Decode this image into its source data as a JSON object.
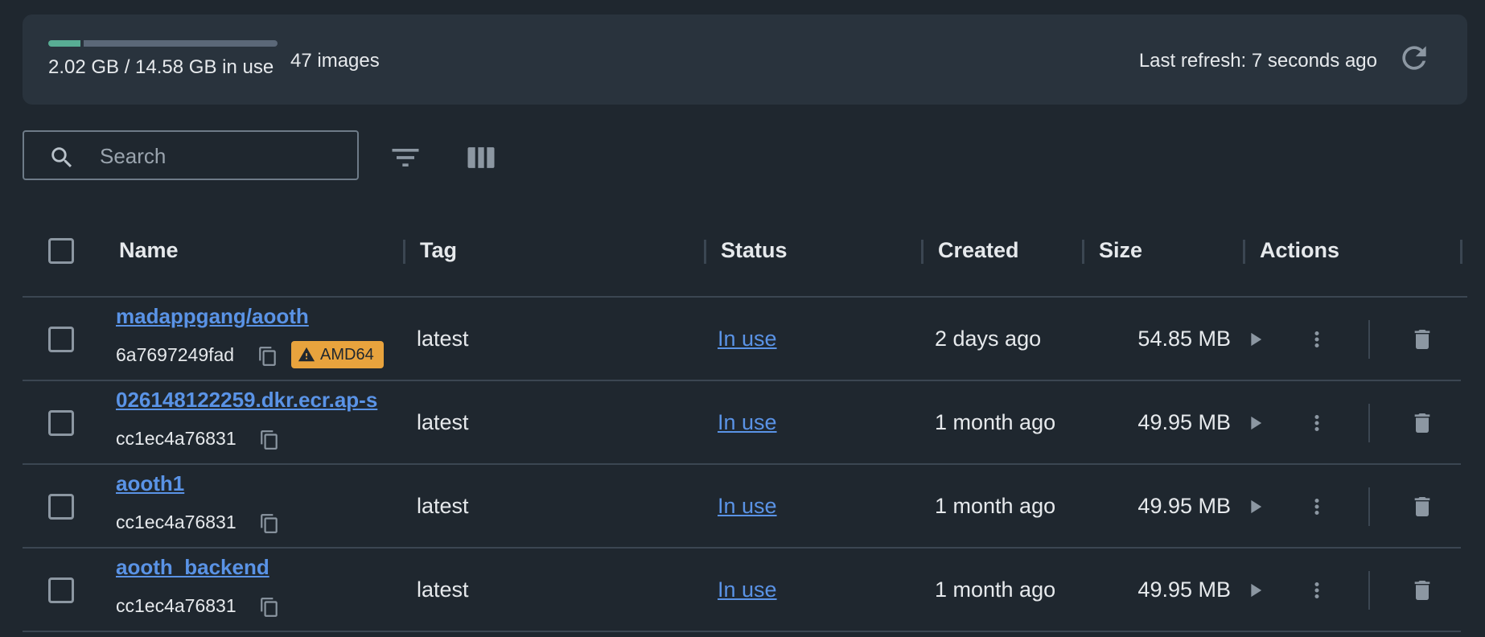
{
  "usage": {
    "used_fraction": 0.139,
    "text": "2.02 GB / 14.58 GB in use",
    "image_count": "47 images",
    "last_refresh": "Last refresh: 7 seconds ago"
  },
  "toolbar": {
    "search_placeholder": "Search"
  },
  "table": {
    "columns": [
      "Name",
      "Tag",
      "Status",
      "Created",
      "Size",
      "Actions"
    ],
    "rows": [
      {
        "name": "madappgang/aooth",
        "id": "6a7697249fad",
        "badge": "AMD64",
        "tag": "latest",
        "status": "In use",
        "created": "2 days ago",
        "size": "54.85 MB"
      },
      {
        "name": "026148122259.dkr.ecr.ap-s",
        "id": "cc1ec4a76831",
        "badge": "",
        "tag": "latest",
        "status": "In use",
        "created": "1 month ago",
        "size": "49.95 MB"
      },
      {
        "name": "aooth1",
        "id": "cc1ec4a76831",
        "badge": "",
        "tag": "latest",
        "status": "In use",
        "created": "1 month ago",
        "size": "49.95 MB"
      },
      {
        "name": "aooth_backend",
        "id": "cc1ec4a76831",
        "badge": "",
        "tag": "latest",
        "status": "In use",
        "created": "1 month ago",
        "size": "49.95 MB"
      }
    ]
  },
  "colors": {
    "accent_link": "#5a93e6",
    "usage_used": "#58ad94",
    "badge_warning": "#e8a33d"
  },
  "icons": [
    "search-icon",
    "filter-icon",
    "columns-icon",
    "refresh-icon",
    "copy-icon",
    "warning-icon",
    "play-icon",
    "more-vertical-icon",
    "trash-icon"
  ]
}
